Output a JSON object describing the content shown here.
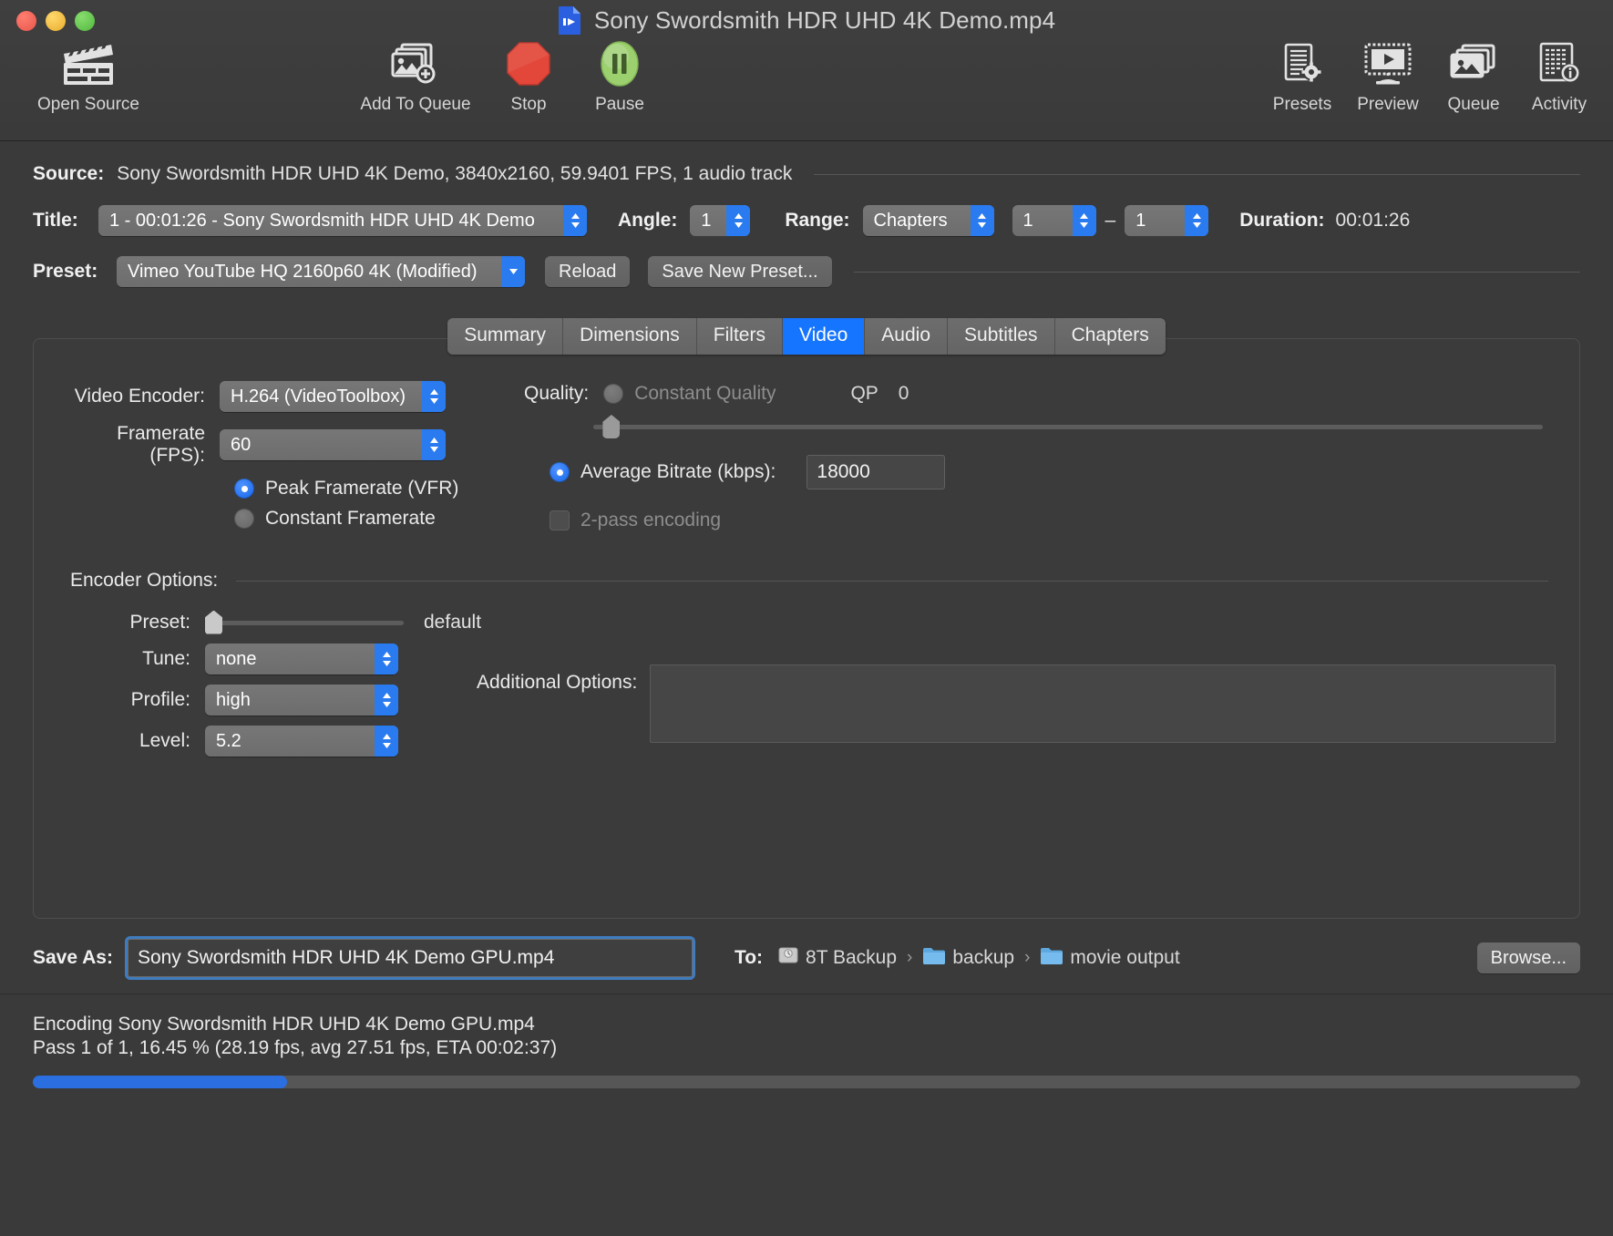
{
  "window": {
    "title": "Sony Swordsmith HDR UHD 4K Demo.mp4",
    "doc_icon": "video-file-icon",
    "traffic_lights": [
      "close-button",
      "minimize-button",
      "zoom-button"
    ]
  },
  "toolbar": {
    "left": [
      {
        "label": "Open Source",
        "icon": "clapperboard-icon"
      },
      {
        "label": "Add To Queue",
        "icon": "add-image-icon"
      },
      {
        "label": "Stop",
        "icon": "stop-octagon-icon"
      },
      {
        "label": "Pause",
        "icon": "pause-icon"
      }
    ],
    "right": [
      {
        "label": "Presets",
        "icon": "presets-gear-icon"
      },
      {
        "label": "Preview",
        "icon": "preview-monitor-icon"
      },
      {
        "label": "Queue",
        "icon": "queue-stack-icon"
      },
      {
        "label": "Activity",
        "icon": "activity-info-icon"
      }
    ]
  },
  "source": {
    "label": "Source:",
    "value": "Sony Swordsmith HDR UHD 4K Demo, 3840x2160, 59.9401 FPS, 1 audio track"
  },
  "title_row": {
    "title_label": "Title:",
    "title_value": "1 - 00:01:26 - Sony Swordsmith HDR UHD 4K Demo",
    "angle_label": "Angle:",
    "angle_value": "1",
    "range_label": "Range:",
    "range_value": "Chapters",
    "range_start": "1",
    "range_dash": "–",
    "range_end": "1",
    "duration_label": "Duration:",
    "duration_value": "00:01:26"
  },
  "preset_row": {
    "label": "Preset:",
    "value": "Vimeo YouTube HQ 2160p60 4K (Modified)",
    "reload": "Reload",
    "save_new": "Save New Preset..."
  },
  "tabs": [
    {
      "label": "Summary",
      "active": false
    },
    {
      "label": "Dimensions",
      "active": false
    },
    {
      "label": "Filters",
      "active": false
    },
    {
      "label": "Video",
      "active": true
    },
    {
      "label": "Audio",
      "active": false
    },
    {
      "label": "Subtitles",
      "active": false
    },
    {
      "label": "Chapters",
      "active": false
    }
  ],
  "video": {
    "encoder_label": "Video Encoder:",
    "encoder_value": "H.264 (VideoToolbox)",
    "framerate_label": "Framerate (FPS):",
    "framerate_value": "60",
    "peak_framerate_label": "Peak Framerate (VFR)",
    "peak_framerate_selected": true,
    "constant_framerate_label": "Constant Framerate",
    "constant_framerate_selected": false,
    "quality_label": "Quality:",
    "constant_quality_label": "Constant Quality",
    "constant_quality_selected": false,
    "qp_label": "QP",
    "qp_value": "0",
    "quality_slider_percent": 1,
    "avg_bitrate_label": "Average Bitrate (kbps):",
    "avg_bitrate_selected": true,
    "avg_bitrate_value": "18000",
    "two_pass_label": "2-pass encoding",
    "two_pass_checked": false
  },
  "encoder_options": {
    "section_label": "Encoder Options:",
    "preset_label": "Preset:",
    "preset_slider_percent": 0,
    "preset_value": "default",
    "tune_label": "Tune:",
    "tune_value": "none",
    "profile_label": "Profile:",
    "profile_value": "high",
    "level_label": "Level:",
    "level_value": "5.2",
    "additional_label": "Additional Options:",
    "additional_value": ""
  },
  "save": {
    "label": "Save As:",
    "filename": "Sony Swordsmith HDR UHD 4K Demo GPU.mp4",
    "to_label": "To:",
    "path": [
      {
        "name": "8T Backup",
        "icon": "hard-drive-icon"
      },
      {
        "name": "backup",
        "icon": "folder-icon"
      },
      {
        "name": "movie output",
        "icon": "folder-icon"
      }
    ],
    "separator": "›",
    "browse": "Browse..."
  },
  "status": {
    "line1": "Encoding Sony Swordsmith HDR UHD 4K Demo GPU.mp4",
    "line2": "Pass 1 of 1, 16.45 % (28.19 fps, avg 27.51 fps, ETA 00:02:37)",
    "progress_percent": 16.45
  },
  "colors": {
    "accent_blue": "#1675ff",
    "progress_blue": "#2a6ee0",
    "window_bg": "#3a3a3a",
    "control_gray": "#6d6d6d",
    "stop_red": "#e2473a",
    "pause_green": "#9ccf6e",
    "folder_blue": "#5ea8e0"
  }
}
